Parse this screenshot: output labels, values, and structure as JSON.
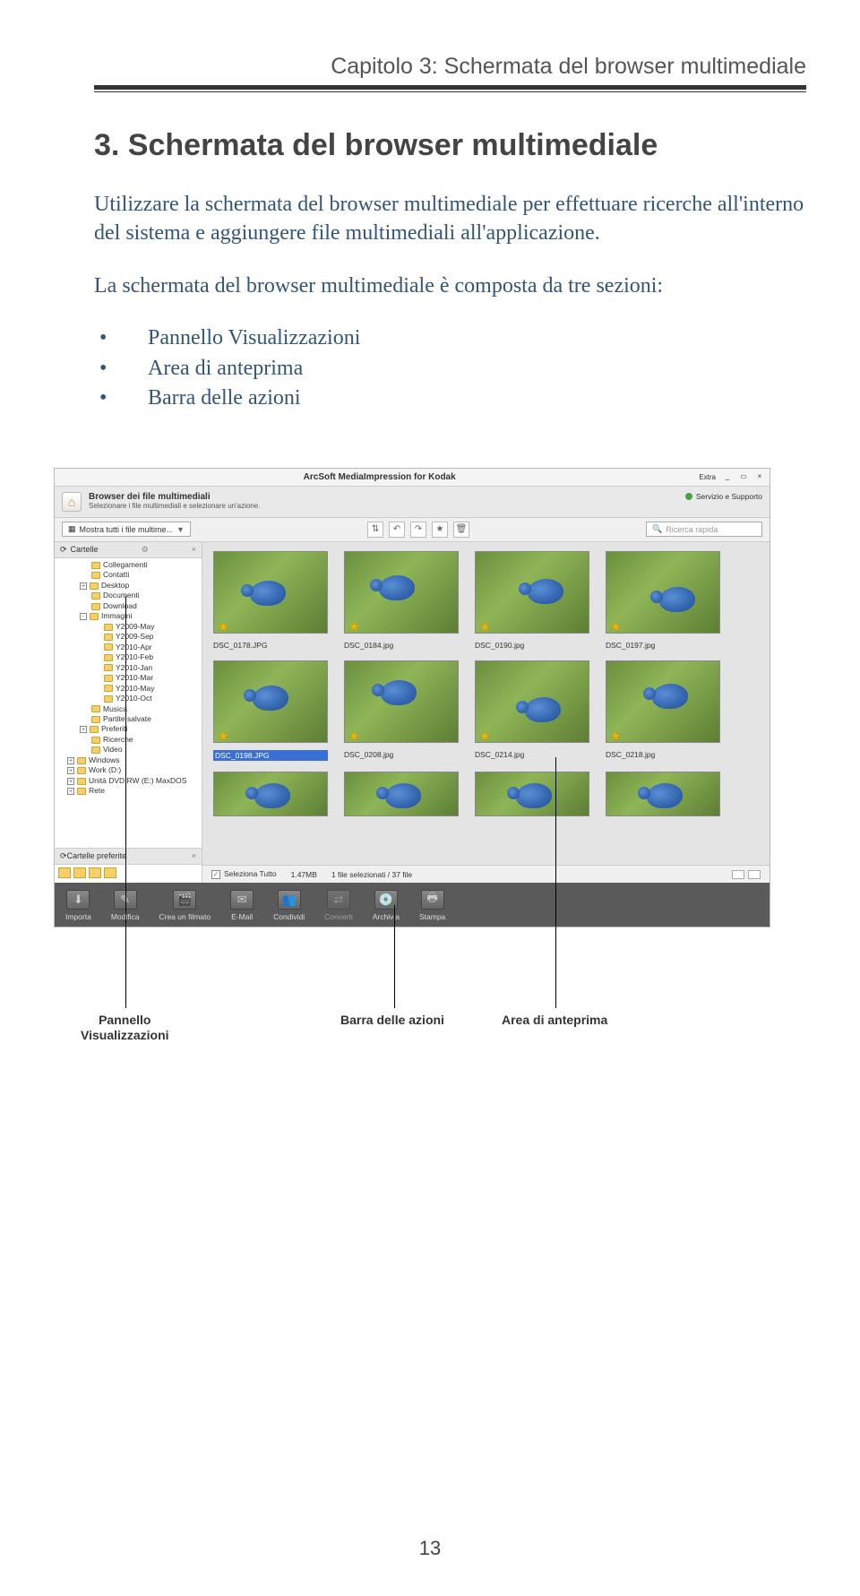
{
  "doc": {
    "chapter_label": "Capitolo 3: Schermata del browser multimediale",
    "heading": "3. Schermata del browser multimediale",
    "para1": "Utilizzare la schermata del browser multimediale per effettuare ricerche all'interno del sistema e aggiungere file multimediali all'applicazione.",
    "para2": "La schermata del browser multimediale è composta da tre sezioni:",
    "bullets": [
      "Pannello Visualizzazioni",
      "Area di anteprima",
      "Barra delle azioni"
    ],
    "page_number": "13"
  },
  "callouts": {
    "left_line1": "Pannello",
    "left_line2": "Visualizzazioni",
    "mid": "Barra delle azioni",
    "right": "Area di anteprima"
  },
  "app": {
    "title": "ArcSoft MediaImpression for Kodak",
    "extra": "Extra",
    "browser_heading": "Browser dei file multimediali",
    "browser_sub": "Selezionare i file multimediali e selezionare un'azione.",
    "service": "Servizio e Supporto",
    "filter_combo": "Mostra tutti i file multime...",
    "search_placeholder": "Ricerca rapida",
    "sidebar": {
      "panel_title": "Cartelle",
      "pref_title": "Cartelle preferite",
      "tree": [
        {
          "lvl": 2,
          "pm": "",
          "label": "Collegamenti"
        },
        {
          "lvl": 2,
          "pm": "",
          "label": "Contatti"
        },
        {
          "lvl": 2,
          "pm": "+",
          "label": "Desktop"
        },
        {
          "lvl": 2,
          "pm": "",
          "label": "Documenti"
        },
        {
          "lvl": 2,
          "pm": "",
          "label": "Download"
        },
        {
          "lvl": 2,
          "pm": "-",
          "label": "Immagini"
        },
        {
          "lvl": 3,
          "pm": "",
          "label": "Y2009-May"
        },
        {
          "lvl": 3,
          "pm": "",
          "label": "Y2009-Sep"
        },
        {
          "lvl": 3,
          "pm": "",
          "label": "Y2010-Apr"
        },
        {
          "lvl": 3,
          "pm": "",
          "label": "Y2010-Feb"
        },
        {
          "lvl": 3,
          "pm": "",
          "label": "Y2010-Jan"
        },
        {
          "lvl": 3,
          "pm": "",
          "label": "Y2010-Mar"
        },
        {
          "lvl": 3,
          "pm": "",
          "label": "Y2010-May"
        },
        {
          "lvl": 3,
          "pm": "",
          "label": "Y2010-Oct"
        },
        {
          "lvl": 2,
          "pm": "",
          "label": "Musica"
        },
        {
          "lvl": 2,
          "pm": "",
          "label": "Partite salvate"
        },
        {
          "lvl": 2,
          "pm": "+",
          "label": "Preferiti"
        },
        {
          "lvl": 2,
          "pm": "",
          "label": "Ricerche"
        },
        {
          "lvl": 2,
          "pm": "",
          "label": "Video"
        },
        {
          "lvl": 1,
          "pm": "+",
          "label": "Windows"
        },
        {
          "lvl": 1,
          "pm": "+",
          "label": "Work (D:)"
        },
        {
          "lvl": 1,
          "pm": "+",
          "label": "Unità DVD RW (E:) MaxDOS"
        },
        {
          "lvl": 1,
          "pm": "+",
          "label": "Rete"
        }
      ]
    },
    "thumbs": {
      "row1": [
        "DSC_0178.JPG",
        "DSC_0184.jpg",
        "DSC_0190.jpg",
        "DSC_0197.jpg"
      ],
      "row2": [
        "DSC_0198.JPG",
        "DSC_0208.jpg",
        "DSC_0214.jpg",
        "DSC_0218.jpg"
      ],
      "selected": "DSC_0198.JPG"
    },
    "status": {
      "select_all": "Seleziona Tutto",
      "size": "1.47MB",
      "count": "1 file selezionati / 37 file"
    },
    "actions": [
      {
        "label": "Importa",
        "icon": "⬇"
      },
      {
        "label": "Modifica",
        "icon": "✎"
      },
      {
        "label": "Crea un filmato",
        "icon": "🎬"
      },
      {
        "label": "E-Mail",
        "icon": "✉"
      },
      {
        "label": "Condividi",
        "icon": "👥"
      },
      {
        "label": "Converti",
        "icon": "⇄",
        "dis": true
      },
      {
        "label": "Archivia",
        "icon": "💿"
      },
      {
        "label": "Stampa",
        "icon": "🖶"
      }
    ]
  }
}
